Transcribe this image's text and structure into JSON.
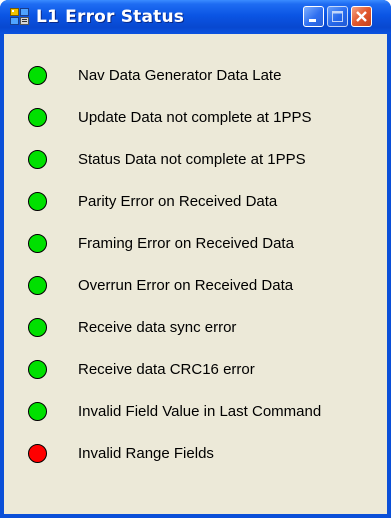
{
  "window": {
    "title": "L1 Error Status",
    "colors": {
      "titlebar": "#0a4fd8",
      "client_background": "#ece9d8",
      "ok": "#00e000",
      "error": "#ff0000"
    },
    "titlebar_buttons": {
      "minimize": "minimize-icon",
      "maximize": "maximize-icon",
      "close": "close-icon"
    }
  },
  "statuses": [
    {
      "label": "Nav Data Generator Data Late",
      "state": "ok"
    },
    {
      "label": "Update Data not complete at 1PPS",
      "state": "ok"
    },
    {
      "label": "Status Data not complete at 1PPS",
      "state": "ok"
    },
    {
      "label": "Parity Error on Received Data",
      "state": "ok"
    },
    {
      "label": "Framing Error on Received Data",
      "state": "ok"
    },
    {
      "label": "Overrun Error on Received Data",
      "state": "ok"
    },
    {
      "label": "Receive data sync error",
      "state": "ok"
    },
    {
      "label": "Receive data CRC16 error",
      "state": "ok"
    },
    {
      "label": "Invalid Field Value in Last Command",
      "state": "ok"
    },
    {
      "label": "Invalid Range Fields",
      "state": "error"
    }
  ]
}
